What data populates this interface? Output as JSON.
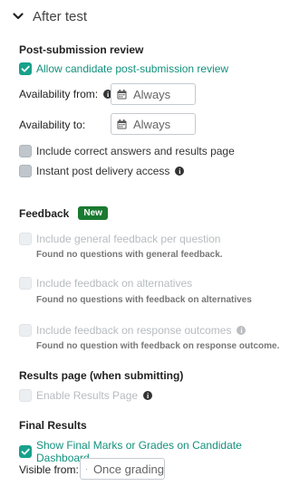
{
  "section": {
    "title": "After test"
  },
  "post_submission": {
    "heading": "Post-submission review",
    "allow_label": "Allow candidate post-submission review",
    "availability_from_label": "Availability from:",
    "availability_from_value": "Always",
    "availability_to_label": "Availability to:",
    "availability_to_value": "Always",
    "include_correct_label": "Include correct answers and results page",
    "instant_access_label": "Instant post delivery access"
  },
  "feedback": {
    "heading": "Feedback",
    "badge": "New",
    "general_label": "Include general feedback per question",
    "general_note": "Found no questions with general feedback.",
    "alternatives_label": "Include feedback on alternatives",
    "alternatives_note": "Found no questions with feedback on alternatives",
    "outcomes_label": "Include feedback on response outcomes",
    "outcomes_note": "Found no question with feedback on response outcome."
  },
  "results_page": {
    "heading": "Results page (when submitting)",
    "enable_label": "Enable Results Page"
  },
  "final_results": {
    "heading": "Final Results",
    "show_label": "Show Final Marks or Grades on Candidate Dashboard",
    "visible_from_label": "Visible from:",
    "visible_from_value": "Once grading"
  },
  "colors": {
    "accent": "#18a18b",
    "badge": "#1a7a31"
  },
  "icons": [
    "chevron-down-icon",
    "calendar-icon",
    "info-icon",
    "checkmark-icon"
  ]
}
